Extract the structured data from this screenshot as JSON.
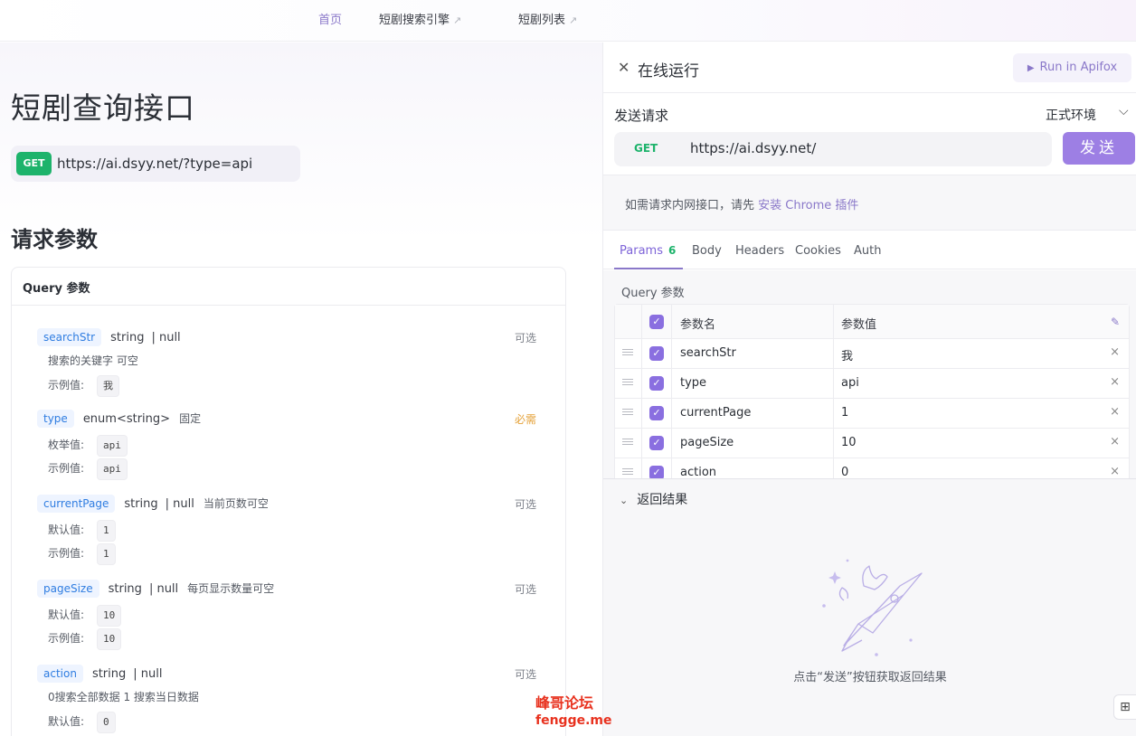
{
  "nav": {
    "home": "首页",
    "search_engine": "短剧搜索引擎",
    "drama_list": "短剧列表",
    "ext_icon": "↗"
  },
  "doc": {
    "title": "短剧查询接口",
    "method": "GET",
    "url": "https://ai.dsyy.net/?type=api",
    "section_title": "请求参数",
    "card_title": "Query 参数",
    "params": [
      {
        "name": "searchStr",
        "type": "string",
        "nullable": "| null",
        "inline_desc": "",
        "requirement": "可选",
        "desc": "搜索的关键字 可空",
        "lines": [
          {
            "label": "示例值:",
            "value": "我"
          }
        ]
      },
      {
        "name": "type",
        "type": "enum<string>",
        "nullable": "",
        "inline_desc": "固定",
        "requirement": "必需",
        "desc": "",
        "lines": [
          {
            "label": "枚举值:",
            "value": "api"
          },
          {
            "label": "示例值:",
            "value": "api"
          }
        ]
      },
      {
        "name": "currentPage",
        "type": "string",
        "nullable": "| null",
        "inline_desc": "当前页数可空",
        "requirement": "可选",
        "desc": "",
        "lines": [
          {
            "label": "默认值:",
            "value": "1"
          },
          {
            "label": "示例值:",
            "value": "1"
          }
        ]
      },
      {
        "name": "pageSize",
        "type": "string",
        "nullable": "| null",
        "inline_desc": "每页显示数量可空",
        "requirement": "可选",
        "desc": "",
        "lines": [
          {
            "label": "默认值:",
            "value": "10"
          },
          {
            "label": "示例值:",
            "value": "10"
          }
        ]
      },
      {
        "name": "action",
        "type": "string",
        "nullable": "| null",
        "inline_desc": "",
        "requirement": "可选",
        "desc": "0搜索全部数据 1 搜索当日数据",
        "lines": [
          {
            "label": "默认值:",
            "value": "0"
          }
        ]
      }
    ]
  },
  "watermark": {
    "line1": "峰哥论坛",
    "line2": "fengge.me"
  },
  "runner": {
    "title": "在线运行",
    "apifox_button": "Run in Apifox",
    "send_request_label": "发送请求",
    "environment": "正式环境",
    "method": "GET",
    "url": "https://ai.dsyy.net/",
    "send_button": "发送",
    "hint_prefix": "如需请求内网接口，请先 ",
    "hint_link": "安装 Chrome 插件",
    "tabs": [
      {
        "label": "Params",
        "count": "6"
      },
      {
        "label": "Body"
      },
      {
        "label": "Headers"
      },
      {
        "label": "Cookies"
      },
      {
        "label": "Auth"
      }
    ],
    "query_label": "Query 参数",
    "table_headers": {
      "name": "参数名",
      "value": "参数值"
    },
    "rows": [
      {
        "name": "searchStr",
        "value": "我"
      },
      {
        "name": "type",
        "value": "api"
      },
      {
        "name": "currentPage",
        "value": "1"
      },
      {
        "name": "pageSize",
        "value": "10"
      },
      {
        "name": "action",
        "value": "0"
      }
    ],
    "result_title": "返回结果",
    "result_hint": "点击“发送”按钮获取返回结果"
  }
}
